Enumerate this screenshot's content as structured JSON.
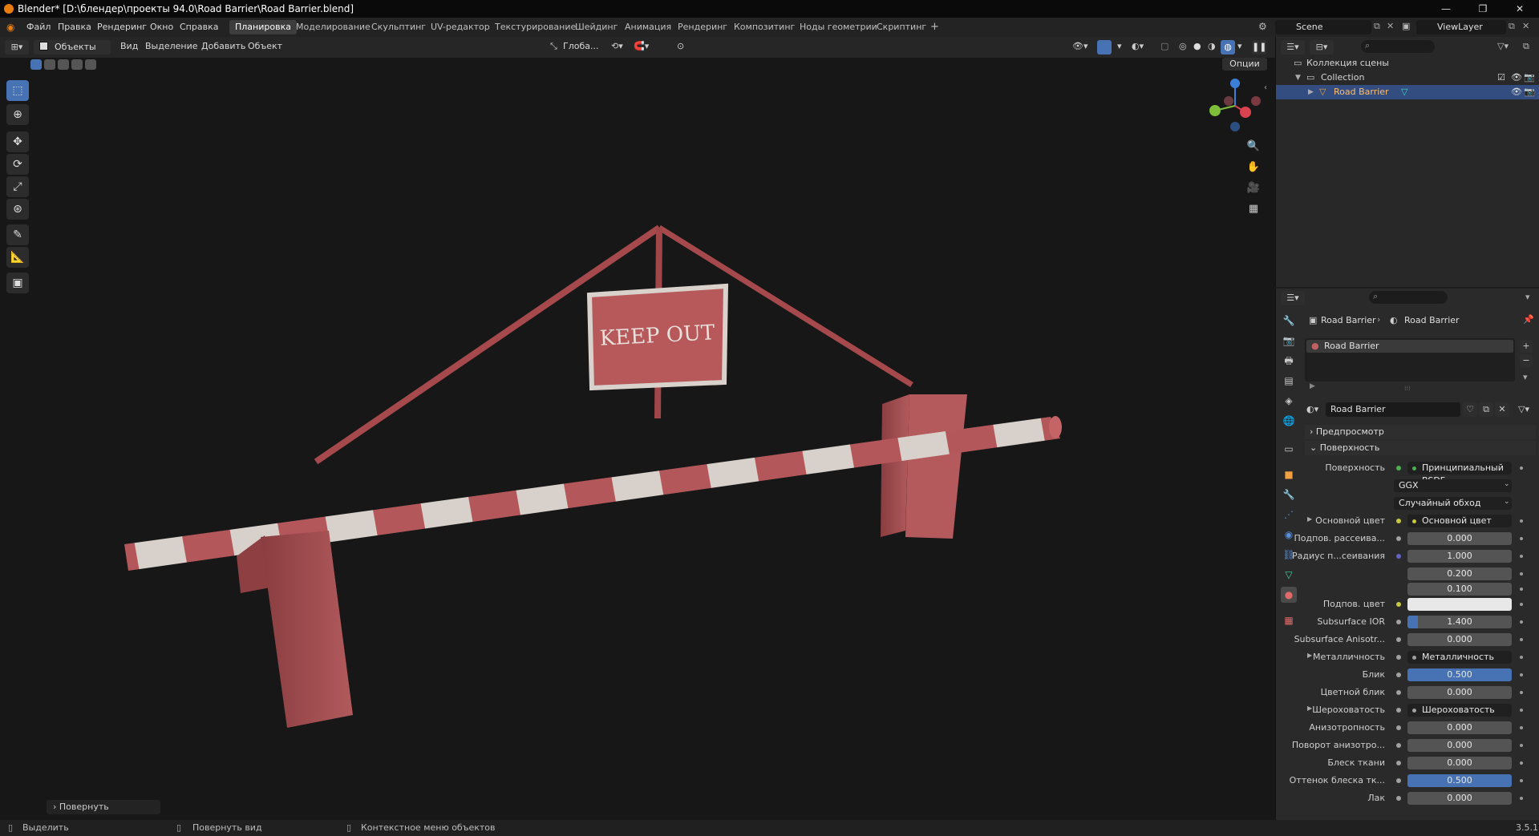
{
  "window": {
    "title": "Blender* [D:\\блендер\\проекты 94.0\\Road Barrier\\Road Barrier.blend]",
    "minimize": "—",
    "restore": "❐",
    "close": "✕"
  },
  "menu": {
    "items": [
      "Файл",
      "Правка",
      "Рендеринг",
      "Окно",
      "Справка"
    ]
  },
  "workspaces": {
    "tabs": [
      "Планировка",
      "Моделирование",
      "Скульптинг",
      "UV-редактор",
      "Текстурирование",
      "Шейдинг",
      "Анимация",
      "Рендеринг",
      "Композитинг",
      "Ноды геометрии",
      "Скриптинг"
    ],
    "add": "+",
    "active_index": 0
  },
  "scene": {
    "name": "Scene",
    "view_layer": "ViewLayer"
  },
  "viewport_header": {
    "mode": "Объекты",
    "menus": [
      "Вид",
      "Выделение",
      "Добавить",
      "Объект"
    ],
    "orientation": "Глоба...",
    "options": "Опции"
  },
  "viewport": {
    "sign_text": "KEEP OUT",
    "redo_panel": "Повернуть"
  },
  "outliner": {
    "scene_collection": "Коллекция сцены",
    "collection": "Collection",
    "object": "Road Barrier"
  },
  "properties": {
    "breadcrumb_object": "Road Barrier",
    "breadcrumb_material": "Road Barrier",
    "slot": "Road Barrier",
    "material_name": "Road Barrier",
    "panel_preview": "Предпросмотр",
    "panel_surface": "Поверхность",
    "rows": [
      {
        "label": "Поверхность",
        "value": "Принципиальный BSDF",
        "kind": "link",
        "dot": "#4caf50"
      },
      {
        "label": "",
        "value": "GGX",
        "kind": "dropdown"
      },
      {
        "label": "",
        "value": "Случайный обход",
        "kind": "dropdown"
      },
      {
        "label": "Основной цвет",
        "value": "Основной цвет",
        "kind": "link",
        "dot": "#c8c83c",
        "expand": true
      },
      {
        "label": "Подпов. рассеива...",
        "value": "0.000",
        "kind": "num",
        "dot": "#a0a0a0"
      },
      {
        "label": "Радиус п...сеивания",
        "value": "1.000",
        "kind": "num",
        "dot": "#6363c7"
      },
      {
        "label": "",
        "value": "0.200",
        "kind": "num"
      },
      {
        "label": "",
        "value": "0.100",
        "kind": "num"
      },
      {
        "label": "Подпов. цвет",
        "value": "",
        "kind": "color",
        "dot": "#c8c83c"
      },
      {
        "label": "Subsurface IOR",
        "value": "1.400",
        "kind": "num",
        "dot": "#a0a0a0",
        "fill": 0.1
      },
      {
        "label": "Subsurface Anisotr...",
        "value": "0.000",
        "kind": "num",
        "dot": "#a0a0a0"
      },
      {
        "label": "Металличность",
        "value": "Металличность",
        "kind": "link",
        "dot": "#a0a0a0",
        "expand": true
      },
      {
        "label": "Блик",
        "value": "0.500",
        "kind": "num",
        "dot": "#a0a0a0",
        "fill": 0.5
      },
      {
        "label": "Цветной блик",
        "value": "0.000",
        "kind": "num",
        "dot": "#a0a0a0"
      },
      {
        "label": "Шероховатость",
        "value": "Шероховатость",
        "kind": "link",
        "dot": "#a0a0a0",
        "expand": true
      },
      {
        "label": "Анизотропность",
        "value": "0.000",
        "kind": "num",
        "dot": "#a0a0a0"
      },
      {
        "label": "Поворот анизотро...",
        "value": "0.000",
        "kind": "num",
        "dot": "#a0a0a0"
      },
      {
        "label": "Блеск ткани",
        "value": "0.000",
        "kind": "num",
        "dot": "#a0a0a0"
      },
      {
        "label": "Оттенок блеска тк...",
        "value": "0.500",
        "kind": "num",
        "dot": "#a0a0a0",
        "fill": 0.5
      },
      {
        "label": "Лак",
        "value": "0.000",
        "kind": "num",
        "dot": "#a0a0a0"
      }
    ]
  },
  "statusbar": {
    "select": "Выделить",
    "rotate_view": "Повернуть вид",
    "context_menu": "Контекстное меню объектов",
    "version": "3.5.1"
  },
  "colors": {
    "accent": "#4772b3",
    "selected_object": "#ffbf6e",
    "barrier_red": "#b4575a",
    "barrier_white": "#d8d0ca"
  }
}
